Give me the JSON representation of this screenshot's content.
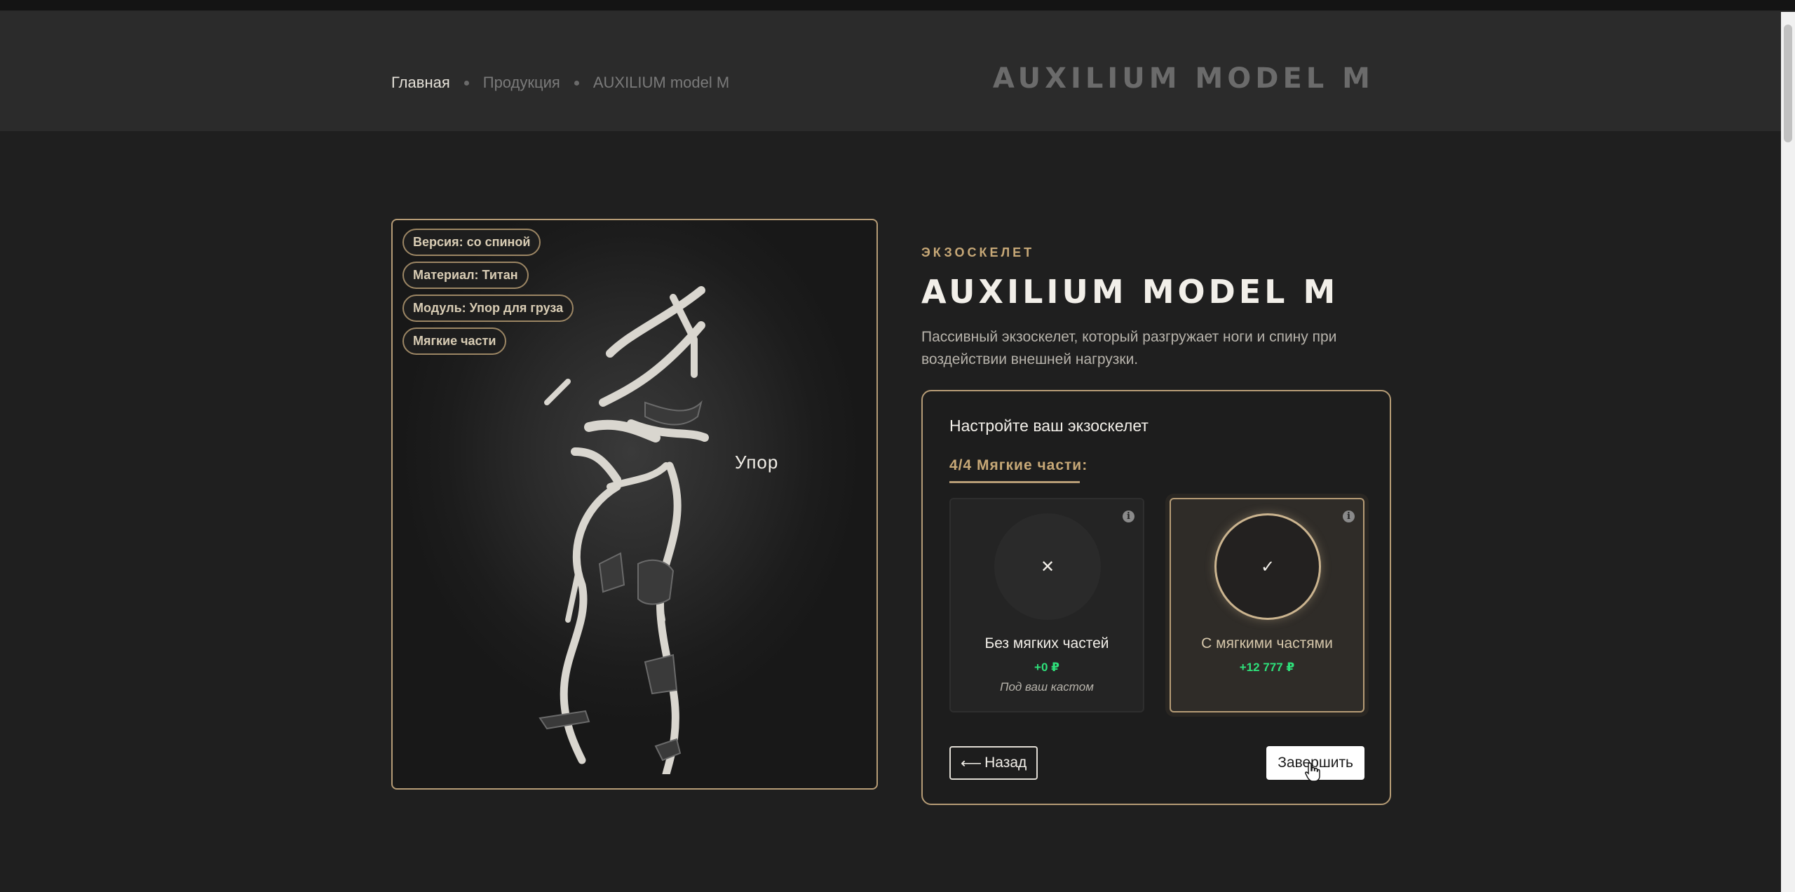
{
  "breadcrumb": {
    "home": "Главная",
    "products": "Продукция",
    "current": "AUXILIUM model M"
  },
  "logo": "AUXILIUM MODEL M",
  "gallery": {
    "tags": [
      "Версия: со спиной",
      "Материал: Титан",
      "Модуль: Упор для груза",
      "Мягкие части"
    ],
    "callout": "Упор"
  },
  "product": {
    "eyebrow": "Экзоскелет",
    "title": "AUXILIUM MODEL M",
    "description": "Пассивный экзоскелет, который разгружает ноги и спину при воздействии внешней нагрузки."
  },
  "configurator": {
    "title": "Настройте ваш экзоскелет",
    "step": "4/4 Мягкие части:",
    "options": [
      {
        "name": "Без мягких частей",
        "price": "+0 ₽",
        "note": "Под ваш кастом",
        "symbol": "✕",
        "selected": false
      },
      {
        "name": "С мягкими частями",
        "price": "+12 777 ₽",
        "symbol": "✓",
        "selected": true
      }
    ],
    "back_label": "Назад",
    "finish_label": "Завершить"
  },
  "colors": {
    "accent": "#b69c76",
    "price": "#2ee07a",
    "background": "#1f1f1f"
  },
  "icons": {
    "info": "info-icon",
    "back": "arrow-left-icon",
    "cursor": "hand-pointer-icon"
  }
}
